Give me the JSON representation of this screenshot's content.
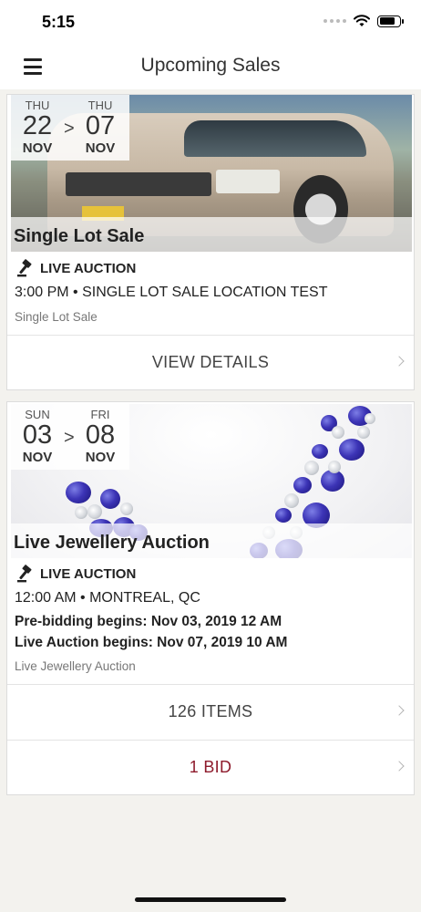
{
  "status_bar": {
    "time": "5:15"
  },
  "nav": {
    "title": "Upcoming Sales"
  },
  "sales": [
    {
      "start": {
        "dow": "THU",
        "day": "22",
        "month": "NOV"
      },
      "end": {
        "dow": "THU",
        "day": "07",
        "month": "NOV"
      },
      "arrow": ">",
      "title": "Single Lot Sale",
      "auction_type": "LIVE AUCTION",
      "time_location": "3:00 PM • SINGLE LOT SALE LOCATION TEST",
      "description": "Single Lot Sale",
      "actions": [
        "VIEW DETAILS"
      ]
    },
    {
      "start": {
        "dow": "SUN",
        "day": "03",
        "month": "NOV"
      },
      "end": {
        "dow": "FRI",
        "day": "08",
        "month": "NOV"
      },
      "arrow": ">",
      "title": "Live Jewellery Auction",
      "auction_type": "LIVE AUCTION",
      "time_location": "12:00 AM • MONTREAL, QC",
      "pre_bidding": "Pre-bidding begins: Nov 03, 2019 12 AM",
      "live_begins": "Live Auction begins: Nov 07, 2019 10 AM",
      "description": "Live Jewellery Auction",
      "actions": [
        "126 ITEMS",
        "1 BID"
      ]
    }
  ],
  "colors": {
    "accent_red": "#8e1b2c",
    "background": "#f3f2ee"
  }
}
